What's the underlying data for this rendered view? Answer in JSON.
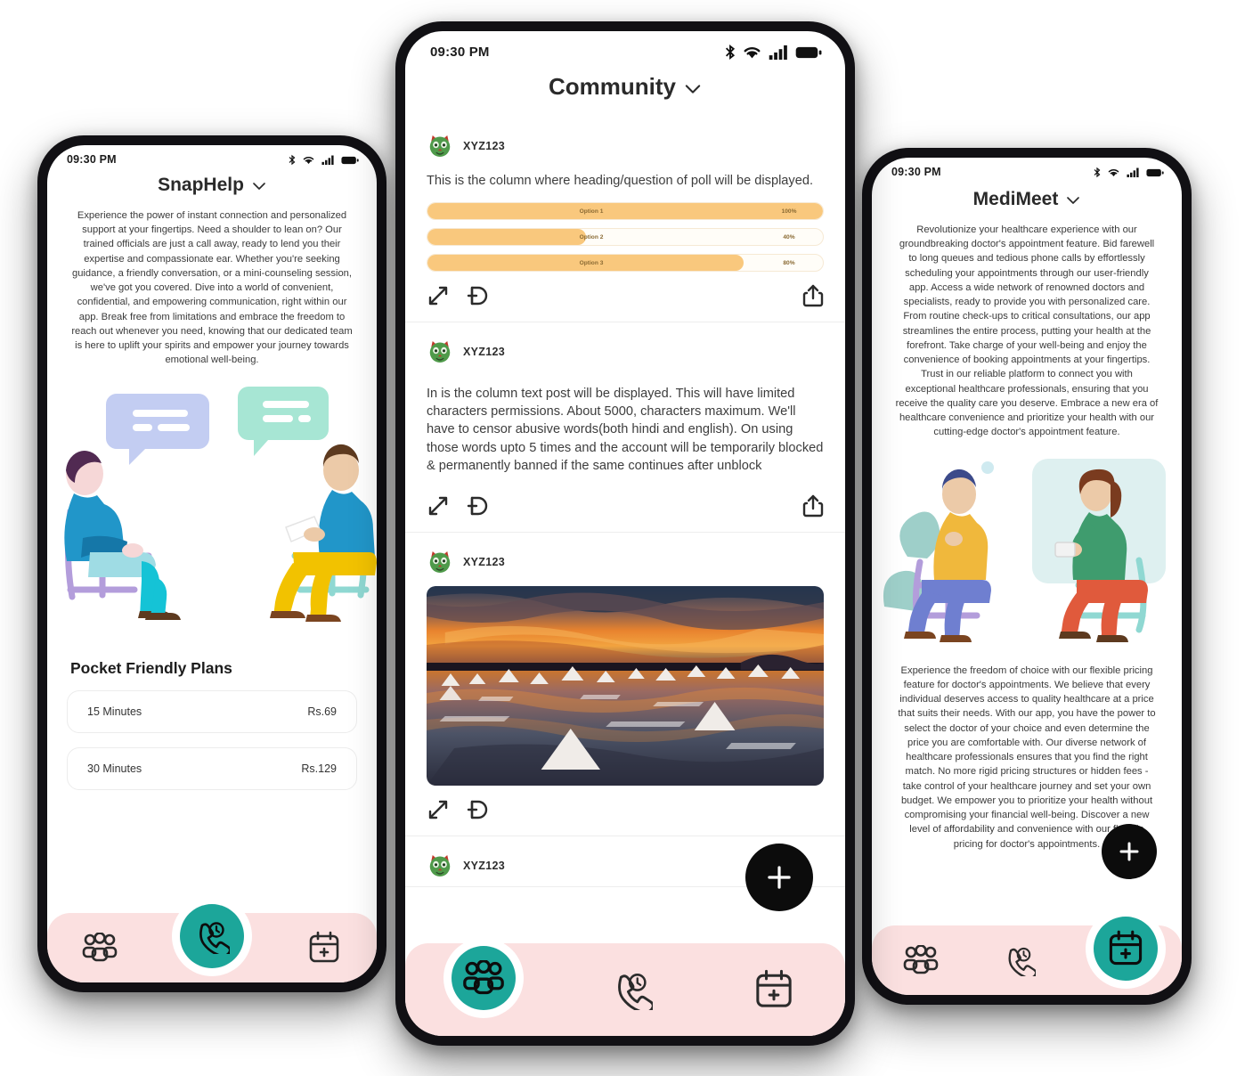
{
  "left_phone": {
    "status": {
      "time": "09:30 PM",
      "icons": [
        "bluetooth-icon",
        "wifi-icon",
        "signal-icon",
        "battery-icon"
      ]
    },
    "title": "SnapHelp",
    "title_chevron": "chevron-down-icon",
    "intro": "Experience the power of instant connection and personalized support at your fingertips. Need a shoulder to lean on? Our trained officials are just a call away, ready to lend you their expertise and compassionate ear. Whether you're seeking guidance, a friendly conversation, or a mini-counseling session, we've got you covered. Dive into a world of convenient, confidential, and empowering communication, right within our app. Break free from limitations and embrace the freedom to reach out whenever you need, knowing that our dedicated team is here to uplift your spirits and empower your journey towards emotional well-being.",
    "plans_heading": "Pocket Friendly Plans",
    "plans": [
      {
        "duration": "15 Minutes",
        "price": "Rs.69"
      },
      {
        "duration": "30 Minutes",
        "price": "Rs.129"
      }
    ],
    "nav": [
      {
        "name": "community",
        "icon": "people-group-icon",
        "active": false
      },
      {
        "name": "call",
        "icon": "phone-clock-icon",
        "active": true
      },
      {
        "name": "appointments",
        "icon": "calendar-plus-icon",
        "active": false
      }
    ]
  },
  "center_phone": {
    "status": {
      "time": "09:30 PM",
      "icons": [
        "bluetooth-icon",
        "wifi-icon",
        "signal-icon",
        "battery-icon"
      ]
    },
    "title": "Community",
    "title_chevron": "chevron-down-icon",
    "posts": [
      {
        "type": "poll",
        "username": "XYZ123",
        "text": "This is the column where heading/question of poll will be displayed.",
        "poll": [
          {
            "label": "Option 1",
            "pct_text": "100%",
            "pct": 100
          },
          {
            "label": "Option 2",
            "pct_text": "40%",
            "pct": 40
          },
          {
            "label": "Option 3",
            "pct_text": "80%",
            "pct": 80
          }
        ],
        "actions": {
          "expand": "expand-arrows-icon",
          "comment": "comment-icon",
          "share": "share-upload-icon"
        }
      },
      {
        "type": "text",
        "username": "XYZ123",
        "text": "In is the column text post will be displayed. This will have limited characters permissions. About 5000, characters maximum. We'll have to censor abusive words(both hindi and english). On using those words upto 5 times and the account will be temporarily blocked & permanently banned if the same continues after unblock",
        "actions": {
          "expand": "expand-arrows-icon",
          "comment": "comment-icon",
          "share": "share-upload-icon"
        }
      },
      {
        "type": "image",
        "username": "XYZ123",
        "image_alt": "salt-flats-sunset-photo",
        "actions": {
          "expand": "expand-arrows-icon",
          "comment": "comment-icon"
        }
      },
      {
        "type": "partial",
        "username": "XYZ123"
      }
    ],
    "fab": {
      "icon": "plus-icon",
      "label": "+"
    },
    "nav": [
      {
        "name": "community",
        "icon": "people-group-icon",
        "active": true
      },
      {
        "name": "call",
        "icon": "phone-clock-icon",
        "active": false
      },
      {
        "name": "appointments",
        "icon": "calendar-plus-icon",
        "active": false
      }
    ]
  },
  "right_phone": {
    "status": {
      "time": "09:30 PM",
      "icons": [
        "bluetooth-icon",
        "wifi-icon",
        "signal-icon",
        "battery-icon"
      ]
    },
    "title": "MediMeet",
    "title_chevron": "chevron-down-icon",
    "intro": "Revolutionize your healthcare experience with our groundbreaking doctor's appointment feature. Bid farewell to long queues and tedious phone calls by effortlessly scheduling your appointments through our user-friendly app. Access a wide network of renowned doctors and specialists, ready to provide you with personalized care. From routine check-ups to critical consultations, our app streamlines the entire process, putting your health at the forefront. Take charge of your well-being and enjoy the convenience of booking appointments at your fingertips. Trust in our reliable platform to connect you with exceptional healthcare professionals, ensuring that you receive the quality care you deserve. Embrace a new era of healthcare convenience and prioritize your health with our cutting-edge doctor's appointment feature.",
    "pricing": "Experience the freedom of choice with our flexible pricing feature for doctor's appointments. We believe that every individual deserves access to quality healthcare at a price that suits their needs. With our app, you have the power to select the doctor of your choice and even determine the price you are comfortable with. Our diverse network of healthcare professionals ensures that you find the right match. No more rigid pricing structures or hidden fees - take control of your healthcare journey and set your own budget. We empower you to prioritize your health without compromising your financial well-being. Discover a new level of affordability and convenience with our flexible pricing for doctor's appointments.",
    "fab": {
      "icon": "plus-icon",
      "label": "+"
    },
    "nav": [
      {
        "name": "community",
        "icon": "people-group-icon",
        "active": false
      },
      {
        "name": "call",
        "icon": "phone-clock-icon",
        "active": false
      },
      {
        "name": "appointments",
        "icon": "calendar-plus-icon",
        "active": true
      }
    ]
  },
  "theme": {
    "accent_teal": "#1ca69a",
    "nav_pink": "#fbe0e0",
    "poll_orange": "#f9c87d",
    "fab_black": "#0c0c0c",
    "text_dark": "#2a2a2a"
  }
}
